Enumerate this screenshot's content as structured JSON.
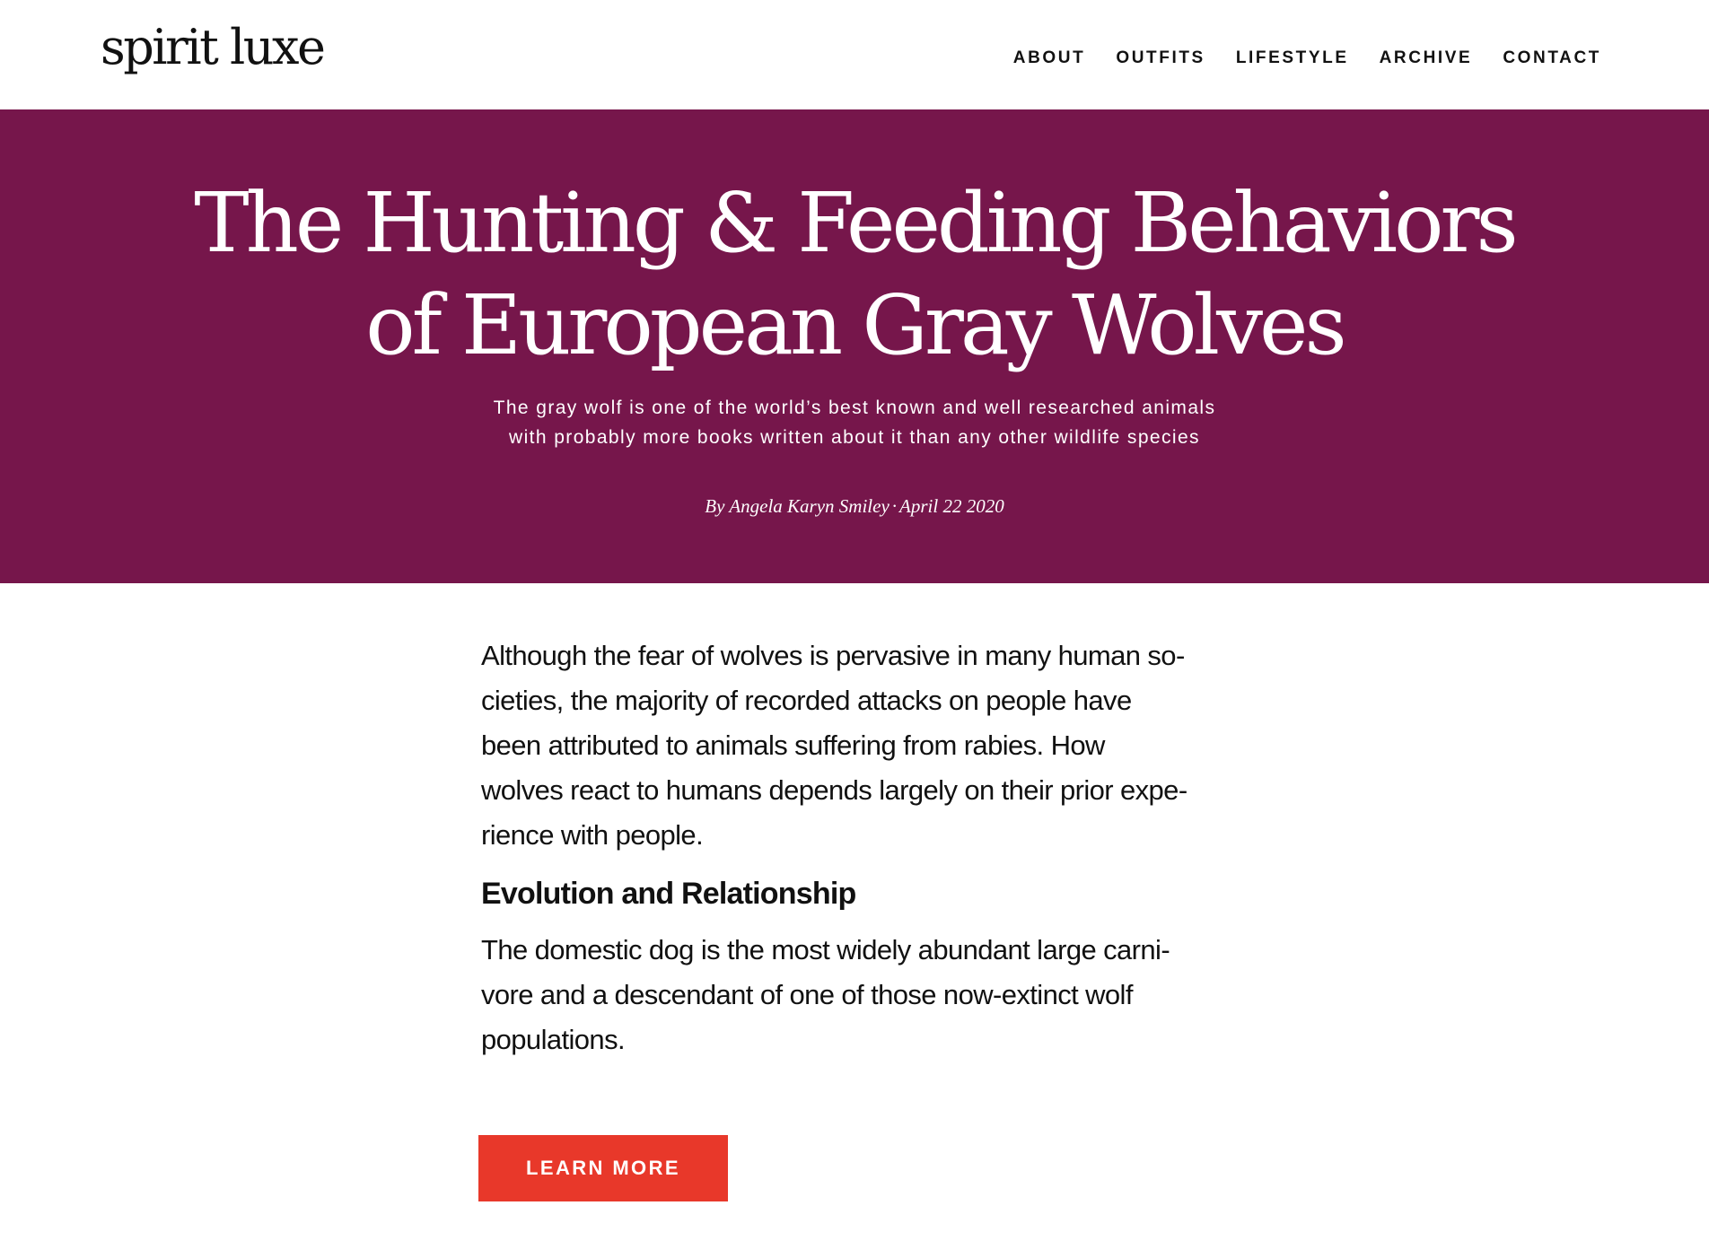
{
  "colors": {
    "hero_background": "#76164b",
    "cta_background": "#e8382a",
    "text": "#111111"
  },
  "header": {
    "logo": "spirit luxe",
    "nav": [
      "ABOUT",
      "OUTFITS",
      "LIFESTYLE",
      "ARCHIVE",
      "CONTACT"
    ]
  },
  "hero": {
    "title_lines": [
      "The Hunting & Feeding Behaviors",
      "of European Gray Wolves"
    ],
    "subtitle_lines": [
      "The gray wolf is one of the world’s best known and well researched animals",
      "with probably more books written about it than any other wildlife species"
    ],
    "author": "By Angela Karyn Smiley",
    "separator": "·",
    "date": "April 22 2020"
  },
  "article": {
    "paragraph1_lines": [
      "Although the fear of wolves is pervasive in many human so-",
      "cieties, the majority of recorded attacks on people have",
      "been attributed to animals suffering from rabies. How",
      "wolves react to humans depends largely on their prior expe-",
      "rience with people."
    ],
    "heading": "Evolution and Relationship",
    "paragraph2_lines": [
      "The domestic dog is the most widely abundant large carni-",
      "vore and a descendant of one of those now-extinct wolf",
      "populations."
    ],
    "cta_label": "LEARN MORE"
  }
}
